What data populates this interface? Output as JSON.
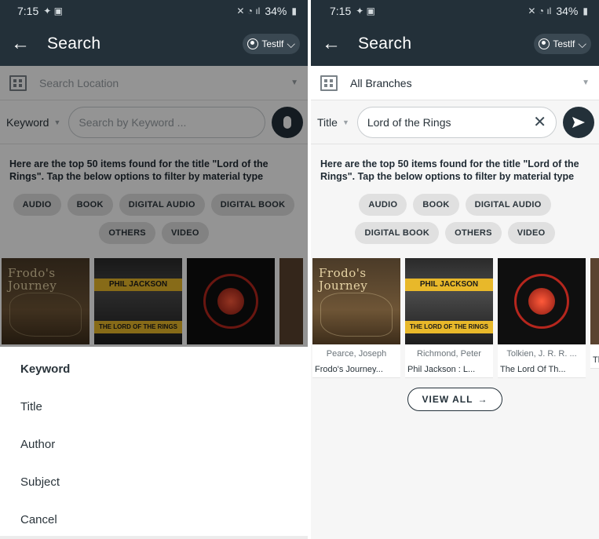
{
  "left": {
    "status": {
      "time": "7:15",
      "battery": "34%"
    },
    "appbar": {
      "title": "Search",
      "user": "Testlf"
    },
    "location": {
      "placeholder": "Search Location"
    },
    "search": {
      "field_type": "Keyword",
      "placeholder": "Search by Keyword ..."
    },
    "results_text": "Here are the top 50 items found for the title \"Lord of the Rings\". Tap the below options to filter by material type",
    "chips": [
      "AUDIO",
      "BOOK",
      "DIGITAL AUDIO",
      "DIGITAL BOOK",
      "OTHERS",
      "VIDEO"
    ],
    "covers": {
      "c1_title": "Frodo's Journey",
      "c2_band": "PHIL JACKSON",
      "c2_band2": "THE LORD OF THE RINGS"
    },
    "menu": [
      "Keyword",
      "Title",
      "Author",
      "Subject",
      "Cancel"
    ]
  },
  "right": {
    "status": {
      "time": "7:15",
      "battery": "34%"
    },
    "appbar": {
      "title": "Search",
      "user": "Testlf"
    },
    "location": {
      "value": "All Branches"
    },
    "search": {
      "field_type": "Title",
      "value": "Lord of the Rings"
    },
    "results_text": "Here are the top 50 items found for the title \"Lord of the Rings\". Tap the below options to filter by material type",
    "chips": [
      "AUDIO",
      "BOOK",
      "DIGITAL AUDIO",
      "DIGITAL BOOK",
      "OTHERS",
      "VIDEO"
    ],
    "covers": {
      "c1_title": "Frodo's Journey",
      "c2_band": "PHIL JACKSON",
      "c2_band2": "THE LORD OF THE RINGS"
    },
    "items": [
      {
        "author": "Pearce, Joseph",
        "title": "Frodo's Journey..."
      },
      {
        "author": "Richmond, Peter",
        "title": "Phil Jackson : L..."
      },
      {
        "author": "Tolkien, J. R. R. ...",
        "title": "The Lord Of Th..."
      },
      {
        "author": "",
        "title": "Th"
      }
    ],
    "view_all": "VIEW ALL",
    "view_all_arrow": "→"
  },
  "colors": {
    "appbar": "#233039",
    "chip": "#e0e0e0",
    "overlay": "rgba(0,0,0,0.42)"
  },
  "icons": [
    "back-arrow-icon",
    "user-icon",
    "chevron-down-icon",
    "building-icon",
    "caret-down-icon",
    "mic-icon",
    "clear-icon",
    "send-icon",
    "arrow-right-icon"
  ]
}
